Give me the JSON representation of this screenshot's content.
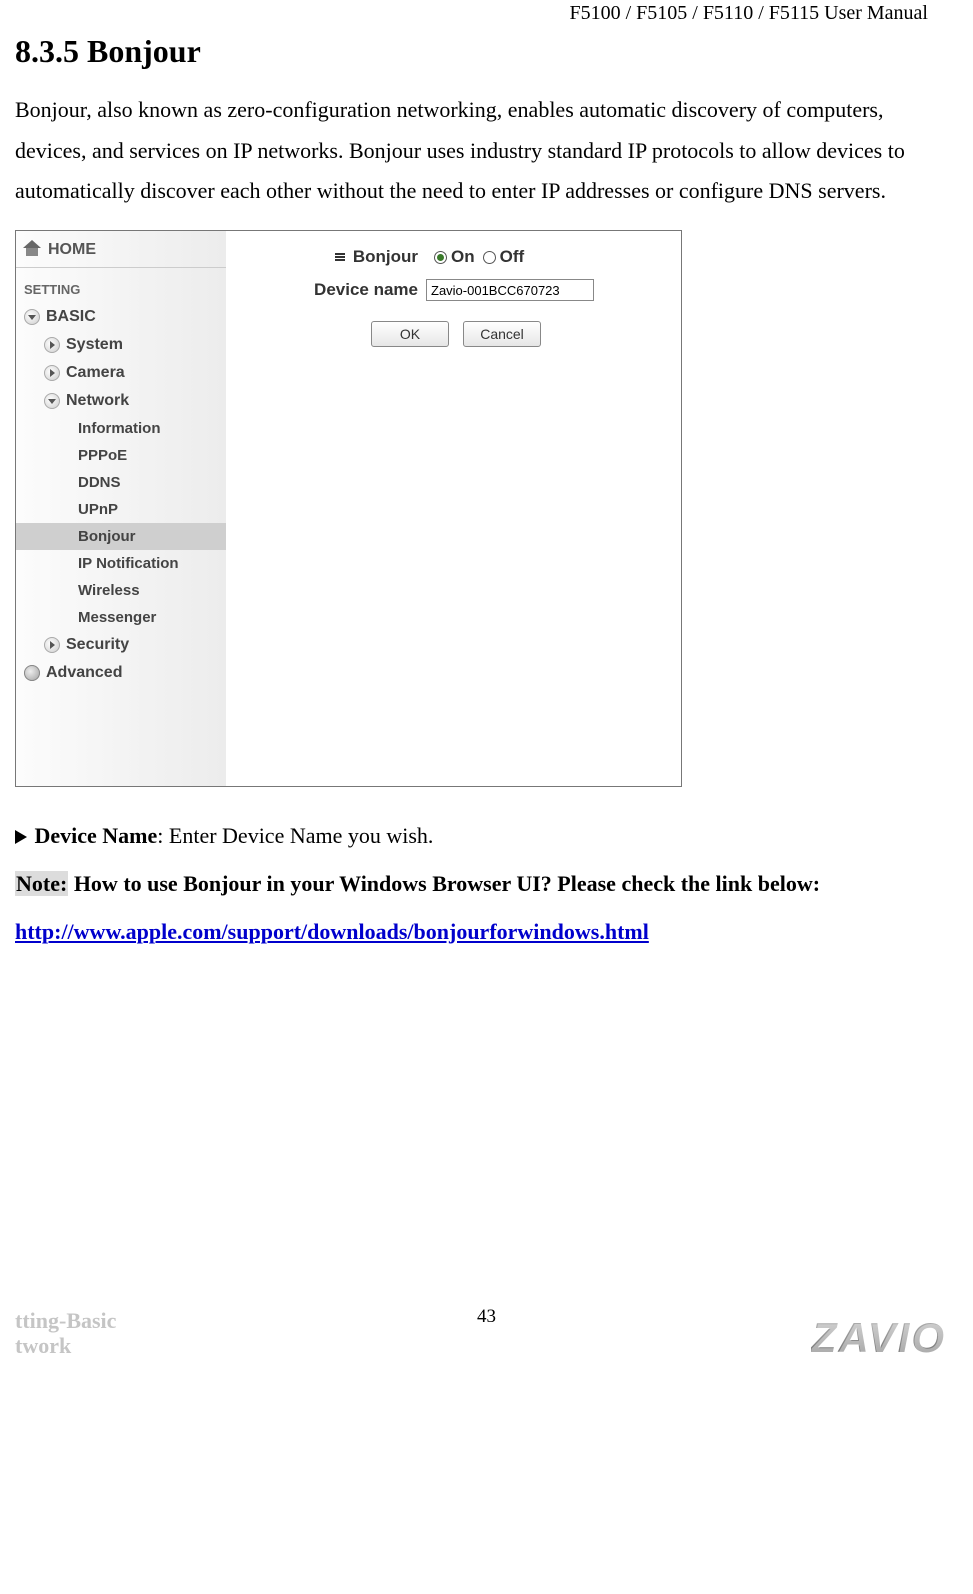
{
  "header": {
    "manual_title": "F5100 / F5105 / F5110 / F5115 User Manual"
  },
  "section": {
    "title": "8.3.5 Bonjour",
    "intro": "Bonjour, also known as zero-configuration networking, enables automatic discovery of computers, devices, and services on IP networks. Bonjour uses industry standard IP protocols to allow devices to automatically discover each other without the need to enter IP addresses or configure DNS servers."
  },
  "sidebar": {
    "home": "HOME",
    "setting": "SETTING",
    "basic": "BASIC",
    "items": {
      "system": "System",
      "camera": "Camera",
      "network": "Network"
    },
    "network_sub": {
      "information": "Information",
      "pppoe": "PPPoE",
      "ddns": "DDNS",
      "upnp": "UPnP",
      "bonjour": "Bonjour",
      "ip_notification": "IP Notification",
      "wireless": "Wireless",
      "messenger": "Messenger"
    },
    "security": "Security",
    "advanced": "Advanced"
  },
  "form": {
    "bonjour_label": "Bonjour",
    "on": "On",
    "off": "Off",
    "device_name_label": "Device name",
    "device_name_value": "Zavio-001BCC670723",
    "ok": "OK",
    "cancel": "Cancel"
  },
  "notes": {
    "device_name_bold": "Device Name",
    "device_name_rest": ": Enter Device Name you wish.",
    "note_label": "Note:",
    "note_text": " How to use Bonjour in your Windows Browser UI? Please check the link below:",
    "link": "http://www.apple.com/support/downloads/bonjourforwindows.html"
  },
  "footer": {
    "left_line1": "tting-Basic",
    "left_line2": "twork",
    "page": "43",
    "logo": "ZAVIO"
  }
}
